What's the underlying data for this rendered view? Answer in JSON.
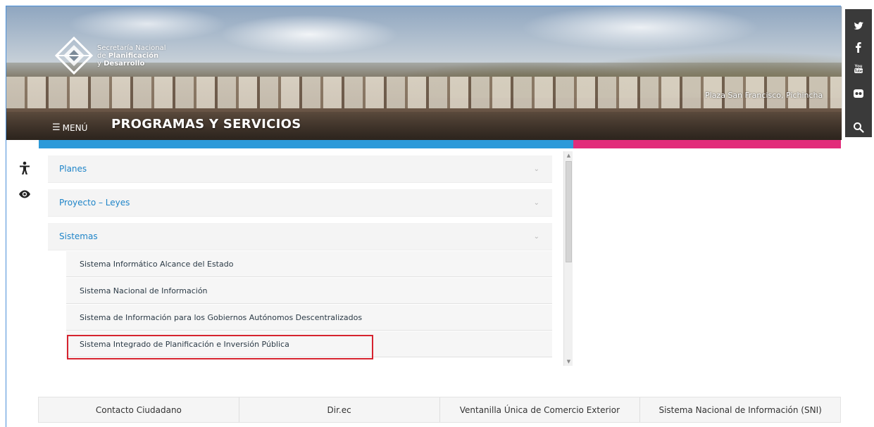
{
  "header": {
    "logo": {
      "line1": "Secretaría Nacional",
      "line2_prefix": "de ",
      "line2_bold": "Planificación",
      "line3_prefix": "y ",
      "line3_bold": "Desarrollo"
    },
    "photo_caption": "Plaza San Francisco, Pichincha",
    "menu_label": "MENÚ",
    "section_title": "PROGRAMAS Y SERVICIOS"
  },
  "social": {
    "icons": [
      "twitter-icon",
      "facebook-icon",
      "youtube-icon",
      "flickr-icon",
      "search-icon"
    ]
  },
  "accessibility": {
    "icons": [
      "accessibility-person-icon",
      "eye-icon"
    ]
  },
  "accordion": {
    "sections": [
      {
        "label": "Planes",
        "expanded": false
      },
      {
        "label": "Proyecto – Leyes",
        "expanded": false
      },
      {
        "label": "Sistemas",
        "expanded": true
      }
    ],
    "sistemas_items": [
      "Sistema Informático Alcance del Estado",
      "Sistema Nacional de Información",
      "Sistema de Información para los Gobiernos Autónomos Descentralizados",
      "Sistema Integrado de Planificación e Inversión Pública"
    ]
  },
  "footer": {
    "links": [
      "Contacto Ciudadano",
      "Dir.ec",
      "Ventanilla Única de Comercio Exterior",
      "Sistema Nacional de Información (SNI)"
    ]
  },
  "colors": {
    "accent_blue": "#2d9ad9",
    "accent_pink": "#e22d7a",
    "link_blue": "#1e84c8",
    "highlight_red": "#d6232f"
  }
}
